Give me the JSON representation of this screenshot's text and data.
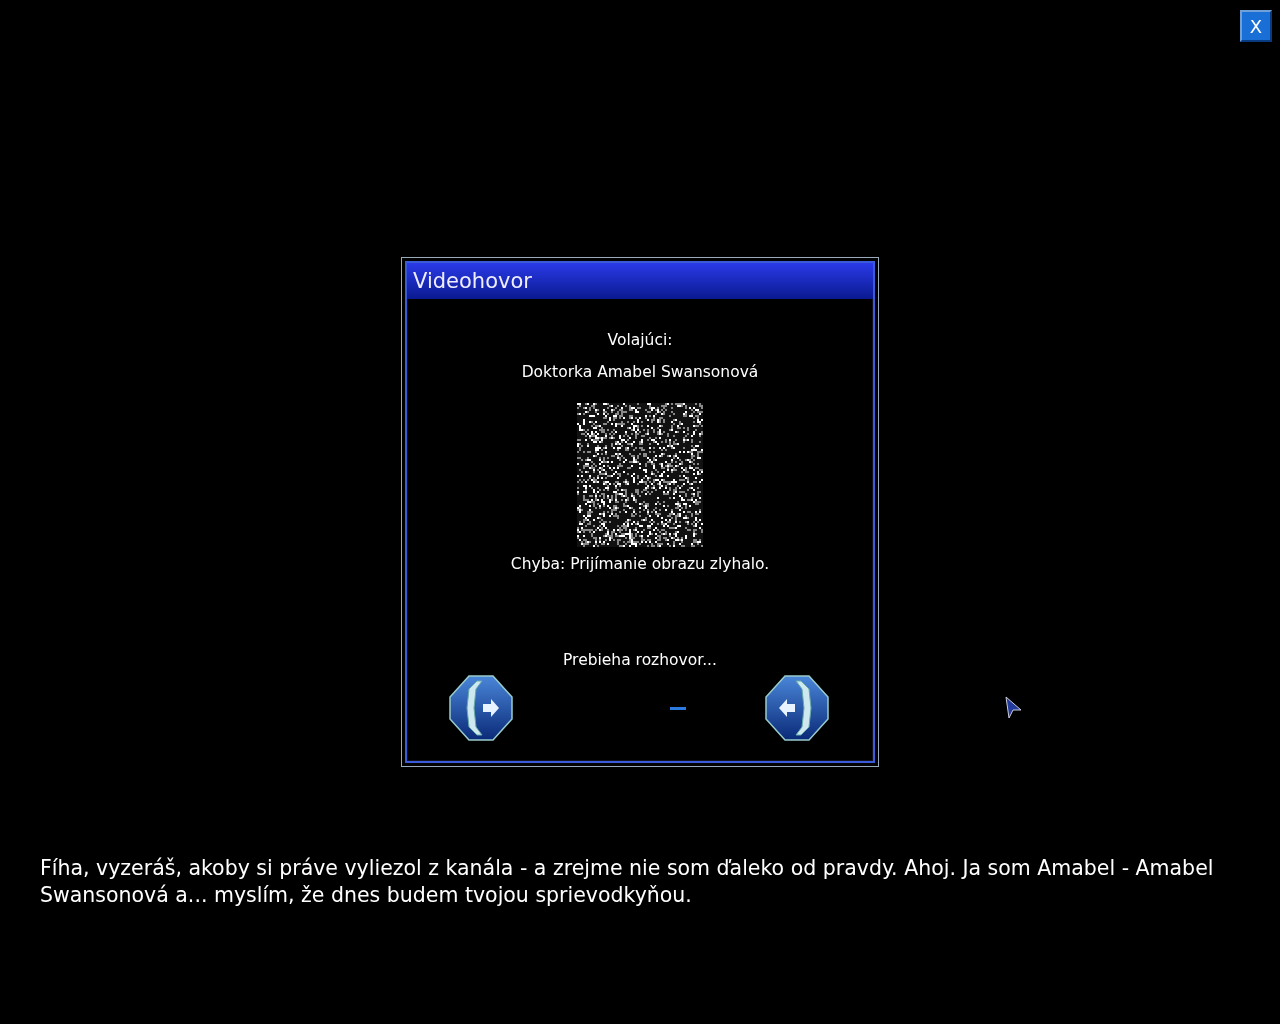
{
  "close_button": {
    "label": "X"
  },
  "dialog": {
    "title": "Videohovor",
    "caller_label": "Volajúci:",
    "caller_name": "Doktorka Amabel Swansonová",
    "error": "Chyba: Prijímanie obrazu zlyhalo.",
    "status": "Prebieha rozhovor..."
  },
  "subtitle": "Fíha, vyzeráš, akoby si práve vyliezol z kanála - a zrejme nie som ďaleko od pravdy. Ahoj. Ja som Amabel - Amabel Swansonová a... myslím, že dnes budem tvojou sprievodkyňou."
}
